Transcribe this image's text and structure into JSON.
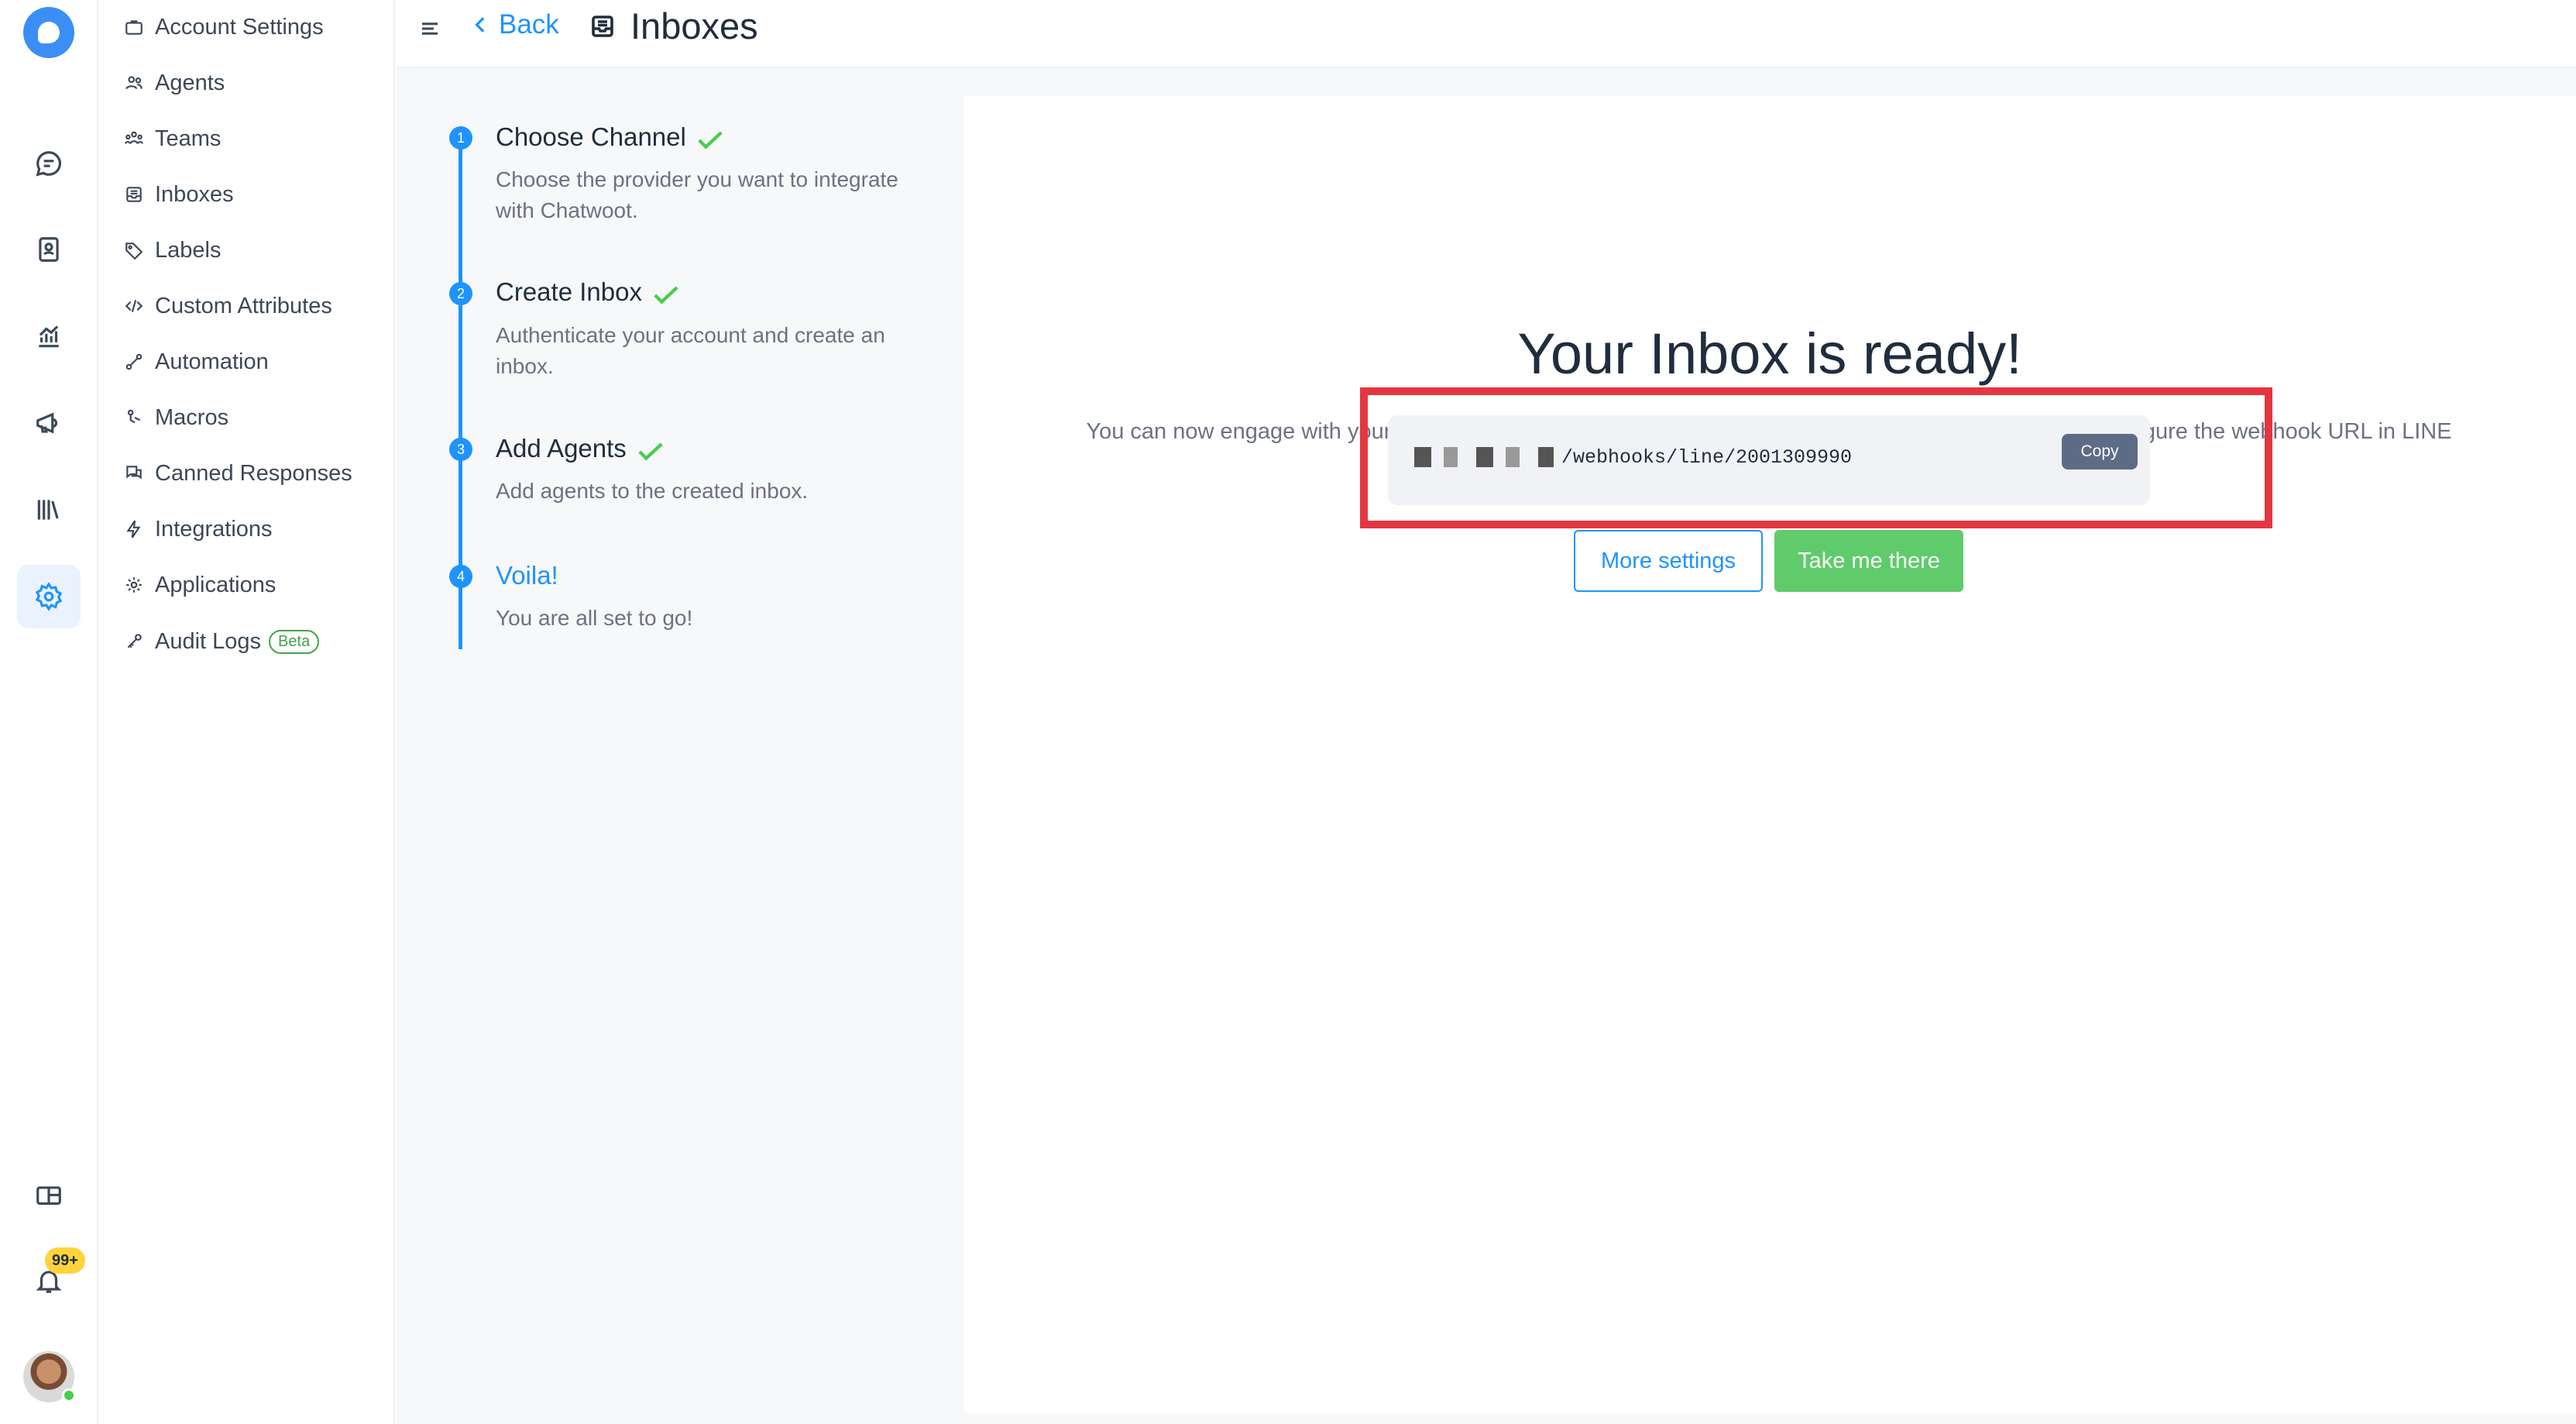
{
  "header": {
    "back_label": "Back",
    "title": "Inboxes"
  },
  "rail": {
    "notification_badge": "99+",
    "icons": [
      "conversations-icon",
      "contacts-icon",
      "reports-icon",
      "campaigns-icon",
      "library-icon",
      "settings-icon",
      "dashboard-apps-icon",
      "notifications-icon"
    ]
  },
  "sidebar": {
    "items": [
      {
        "label": "Account Settings",
        "icon": "briefcase-icon"
      },
      {
        "label": "Agents",
        "icon": "people-icon"
      },
      {
        "label": "Teams",
        "icon": "team-icon"
      },
      {
        "label": "Inboxes",
        "icon": "inbox-icon"
      },
      {
        "label": "Labels",
        "icon": "tag-icon"
      },
      {
        "label": "Custom Attributes",
        "icon": "code-icon"
      },
      {
        "label": "Automation",
        "icon": "automation-icon"
      },
      {
        "label": "Macros",
        "icon": "macro-icon"
      },
      {
        "label": "Canned Responses",
        "icon": "chat-bubbles-icon"
      },
      {
        "label": "Integrations",
        "icon": "flash-icon"
      },
      {
        "label": "Applications",
        "icon": "gear-puzzle-icon"
      },
      {
        "label": "Audit Logs",
        "icon": "key-icon",
        "badge": "Beta"
      }
    ]
  },
  "steps": [
    {
      "num": "1",
      "title": "Choose Channel",
      "desc": "Choose the provider you want to integrate with Chatwoot.",
      "done": true
    },
    {
      "num": "2",
      "title": "Create Inbox",
      "desc": "Authenticate your account and create an inbox.",
      "done": true
    },
    {
      "num": "3",
      "title": "Add Agents",
      "desc": "Add agents to the created inbox.",
      "done": true
    },
    {
      "num": "4",
      "title": "Voila!",
      "desc": "You are all set to go!",
      "done": false
    }
  ],
  "main": {
    "title": "Your Inbox is ready!",
    "description": "You can now engage with your customers through your new Channel. Happy supporting. You have to configure the webhook URL in LINE application with the URL mentioned here.",
    "webhook_url_visible": "/webhooks/line/2001309990",
    "copy_label": "Copy",
    "more_settings_label": "More settings",
    "take_me_there_label": "Take me there"
  },
  "colors": {
    "accent": "#1f93ff",
    "success": "#5fcb6a",
    "highlight": "#e5363f"
  }
}
